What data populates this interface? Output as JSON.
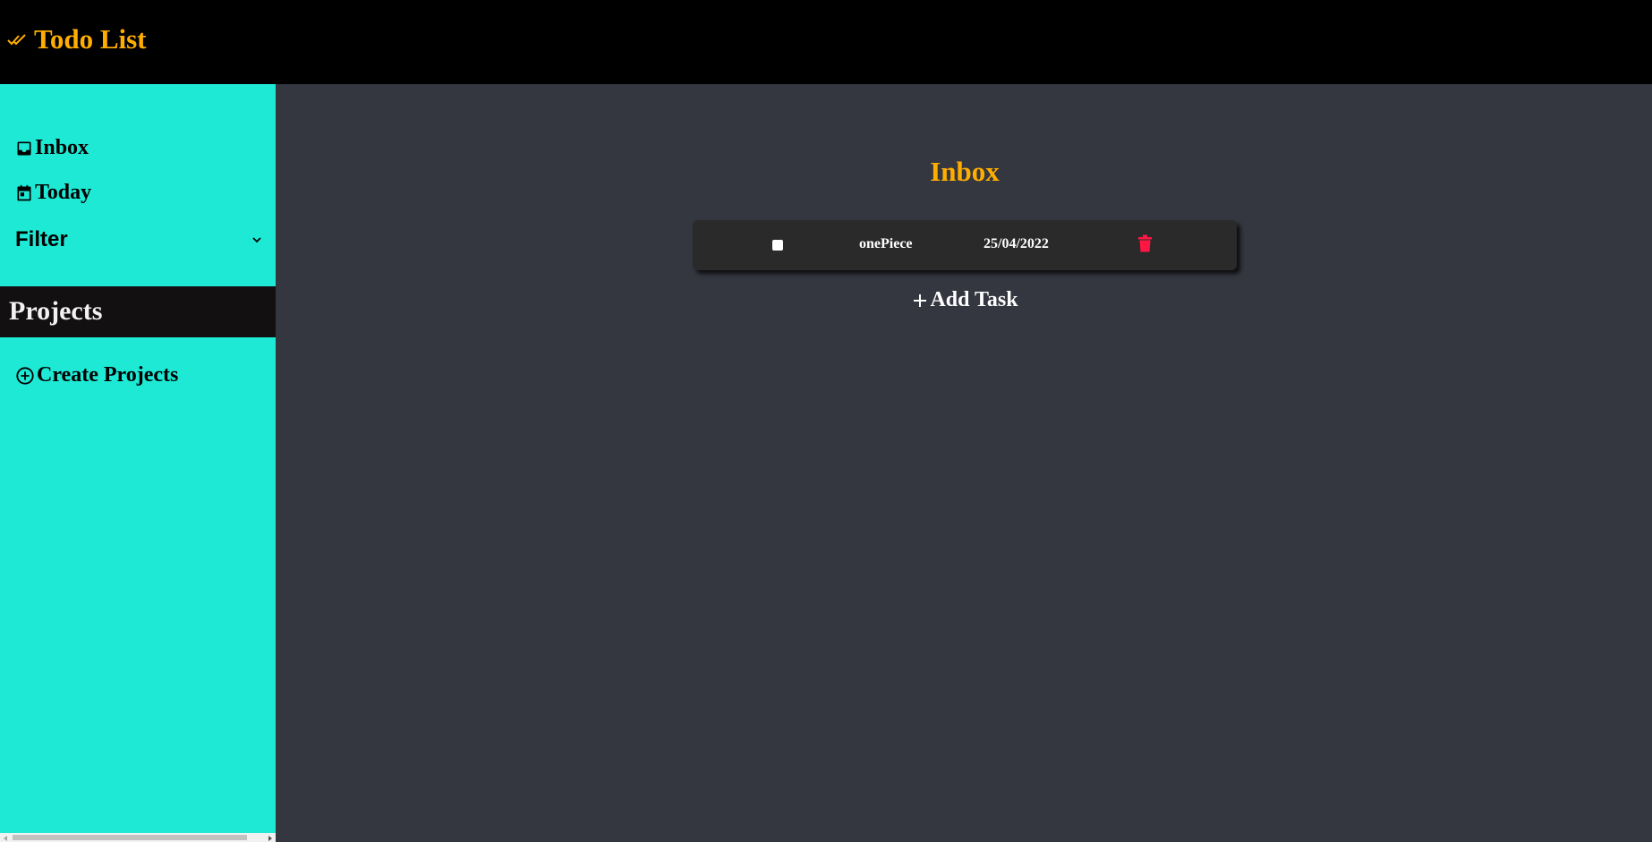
{
  "app": {
    "title": "Todo List",
    "icon": "double-check-icon",
    "accent_color": "#ffae00"
  },
  "sidebar": {
    "background": "#1de9d5",
    "items": [
      {
        "label": "Inbox",
        "icon": "inbox-icon"
      },
      {
        "label": "Today",
        "icon": "calendar-today-icon"
      }
    ],
    "filter": {
      "label": "Filter",
      "icon": "chevron-down-icon"
    },
    "projects": {
      "title": "Projects",
      "create_label": "Create Projects",
      "create_icon": "plus-circle-icon"
    }
  },
  "main": {
    "title": "Inbox",
    "tasks": [
      {
        "name": "onePiece",
        "date": "25/04/2022",
        "completed": false,
        "delete_icon": "trash-icon",
        "delete_color": "#ff1744"
      }
    ],
    "add_task_label": "Add Task",
    "add_task_icon": "plus-icon"
  }
}
